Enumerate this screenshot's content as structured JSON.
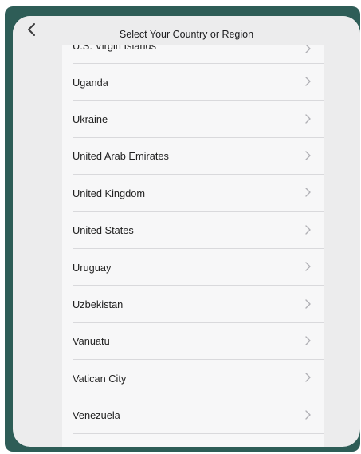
{
  "header": {
    "title": "Select Your Country or Region",
    "back_icon": "chevron-left-icon"
  },
  "countries": [
    "U.S. Virgin Islands",
    "Uganda",
    "Ukraine",
    "United Arab Emirates",
    "United Kingdom",
    "United States",
    "Uruguay",
    "Uzbekistan",
    "Vanuatu",
    "Vatican City",
    "Venezuela"
  ],
  "row_icon": "chevron-right-icon",
  "colors": {
    "bezel": "#2e5d57",
    "screen": "#ececed",
    "list_bg": "#f7f7f8"
  }
}
